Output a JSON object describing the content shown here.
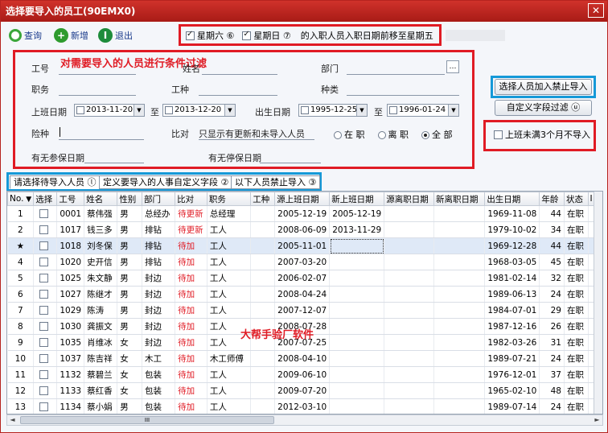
{
  "window": {
    "title": "选择要导入的员工(90EMX0)",
    "close_glyph": "✕"
  },
  "toolbar": {
    "query": "查询",
    "add": "新增",
    "exit": "退出"
  },
  "weekend": {
    "saturday": "星期六 ⑥",
    "sunday": "星期日 ⑦",
    "note": "的入职人员入职日期前移至星期五",
    "saturday_checked": true,
    "sunday_checked": true
  },
  "filter": {
    "hint": "对需要导入的人员进行条件过滤",
    "emp_no_label": "工号",
    "name_label": "姓名",
    "dept_label": "部门",
    "position_label": "职务",
    "worktype_label": "工种",
    "type_label": "种类",
    "join_date_label": "上班日期",
    "join_from": "2013-11-20",
    "join_to": "2013-12-20",
    "to1": "至",
    "birth_label": "出生日期",
    "birth_from": "1995-12-25",
    "birth_to": "1996-01-24",
    "to2": "至",
    "insurance_label": "险种",
    "compare_label": "比对",
    "compare_value": "只显示有更新和未导入人员",
    "status_options": [
      "在 职",
      "离 职",
      "全 部"
    ],
    "status_selected": 2,
    "has_insurance_date_label": "有无参保日期",
    "has_stop_date_label": "有无停保日期"
  },
  "actions": {
    "add_to_forbid": "选择人员加入禁止导入",
    "custom_filter": "自定义字段过滤 ⓤ",
    "less_than_3_months": "上班未满3个月不导入"
  },
  "tabs": [
    "请选择待导入人员 ⓛ",
    "定义要导入的人事自定义字段 ②",
    "以下人员禁止导入 ③"
  ],
  "grid": {
    "columns": [
      "No.",
      "选择",
      "工号",
      "姓名",
      "性别",
      "部门",
      "比对",
      "职务",
      "工种",
      "源上班日期",
      "新上班日期",
      "源离职日期",
      "新离职日期",
      "出生日期",
      "年龄",
      "状态",
      "I"
    ],
    "rows": [
      {
        "no": "1",
        "emp_no": "0001",
        "name": "蔡伟强",
        "gender": "男",
        "dept": "总经办",
        "compare": "待更新",
        "position": "总经理",
        "worktype": "",
        "src_join": "2005-12-19",
        "new_join": "2005-12-19",
        "src_leave": "",
        "new_leave": "",
        "birth": "1969-11-08",
        "age": "44",
        "status": "在职"
      },
      {
        "no": "2",
        "emp_no": "1017",
        "name": "钱三多",
        "gender": "男",
        "dept": "排钻",
        "compare": "待更新",
        "position": "工人",
        "worktype": "",
        "src_join": "2008-06-09",
        "new_join": "2013-11-29",
        "src_leave": "",
        "new_leave": "",
        "birth": "1979-10-02",
        "age": "34",
        "status": "在职"
      },
      {
        "no": "★",
        "emp_no": "1018",
        "name": "刘冬保",
        "gender": "男",
        "dept": "排钻",
        "compare": "待加",
        "position": "工人",
        "worktype": "",
        "src_join": "2005-11-01",
        "new_join": "",
        "src_leave": "",
        "new_leave": "",
        "birth": "1969-12-28",
        "age": "44",
        "status": "在职"
      },
      {
        "no": "4",
        "emp_no": "1020",
        "name": "史开信",
        "gender": "男",
        "dept": "排钻",
        "compare": "待加",
        "position": "工人",
        "worktype": "",
        "src_join": "2007-03-20",
        "new_join": "",
        "src_leave": "",
        "new_leave": "",
        "birth": "1968-03-05",
        "age": "45",
        "status": "在职"
      },
      {
        "no": "5",
        "emp_no": "1025",
        "name": "朱文静",
        "gender": "男",
        "dept": "封边",
        "compare": "待加",
        "position": "工人",
        "worktype": "",
        "src_join": "2006-02-07",
        "new_join": "",
        "src_leave": "",
        "new_leave": "",
        "birth": "1981-02-14",
        "age": "32",
        "status": "在职"
      },
      {
        "no": "6",
        "emp_no": "1027",
        "name": "陈继才",
        "gender": "男",
        "dept": "封边",
        "compare": "待加",
        "position": "工人",
        "worktype": "",
        "src_join": "2008-04-24",
        "new_join": "",
        "src_leave": "",
        "new_leave": "",
        "birth": "1989-06-13",
        "age": "24",
        "status": "在职"
      },
      {
        "no": "7",
        "emp_no": "1029",
        "name": "陈涛",
        "gender": "男",
        "dept": "封边",
        "compare": "待加",
        "position": "工人",
        "worktype": "",
        "src_join": "2007-12-07",
        "new_join": "",
        "src_leave": "",
        "new_leave": "",
        "birth": "1984-07-01",
        "age": "29",
        "status": "在职"
      },
      {
        "no": "8",
        "emp_no": "1030",
        "name": "龚振文",
        "gender": "男",
        "dept": "封边",
        "compare": "待加",
        "position": "工人",
        "worktype": "",
        "src_join": "2008-07-28",
        "new_join": "",
        "src_leave": "",
        "new_leave": "",
        "birth": "1987-12-16",
        "age": "26",
        "status": "在职"
      },
      {
        "no": "9",
        "emp_no": "1035",
        "name": "肖维冰",
        "gender": "女",
        "dept": "封边",
        "compare": "待加",
        "position": "工人",
        "worktype": "",
        "src_join": "2007-07-25",
        "new_join": "",
        "src_leave": "",
        "new_leave": "",
        "birth": "1982-03-26",
        "age": "31",
        "status": "在职"
      },
      {
        "no": "10",
        "emp_no": "1037",
        "name": "陈吉祥",
        "gender": "女",
        "dept": "木工",
        "compare": "待加",
        "position": "木工师傅",
        "worktype": "",
        "src_join": "2008-04-10",
        "new_join": "",
        "src_leave": "",
        "new_leave": "",
        "birth": "1989-07-21",
        "age": "24",
        "status": "在职"
      },
      {
        "no": "11",
        "emp_no": "1132",
        "name": "蔡碧兰",
        "gender": "女",
        "dept": "包装",
        "compare": "待加",
        "position": "工人",
        "worktype": "",
        "src_join": "2009-06-10",
        "new_join": "",
        "src_leave": "",
        "new_leave": "",
        "birth": "1976-12-01",
        "age": "37",
        "status": "在职"
      },
      {
        "no": "12",
        "emp_no": "1133",
        "name": "蔡红香",
        "gender": "女",
        "dept": "包装",
        "compare": "待加",
        "position": "工人",
        "worktype": "",
        "src_join": "2009-07-20",
        "new_join": "",
        "src_leave": "",
        "new_leave": "",
        "birth": "1965-02-10",
        "age": "48",
        "status": "在职"
      },
      {
        "no": "13",
        "emp_no": "1134",
        "name": "蔡小娟",
        "gender": "男",
        "dept": "包装",
        "compare": "待加",
        "position": "工人",
        "worktype": "",
        "src_join": "2012-03-10",
        "new_join": "",
        "src_leave": "",
        "new_leave": "",
        "birth": "1989-07-14",
        "age": "24",
        "status": "在职"
      }
    ],
    "selected_row": 2
  },
  "watermark": "大帮手验厂软件",
  "colors": {
    "title_bar": "#c62821",
    "highlight_red": "#e01b24",
    "highlight_blue": "#1599d8",
    "selected_row": "#dfe9f7"
  },
  "icons": {
    "query": "search-icon",
    "add": "plus-icon",
    "exit": "power-icon",
    "filter": "funnel-icon"
  }
}
